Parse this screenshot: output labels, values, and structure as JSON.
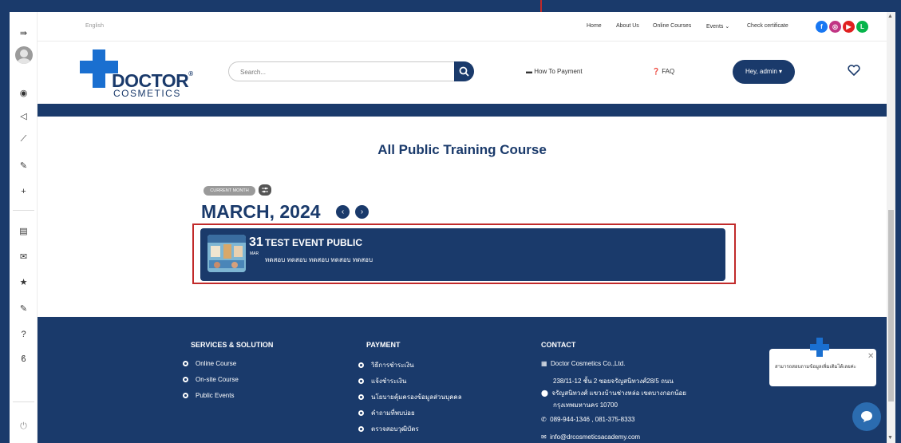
{
  "topbar": {
    "language": "English",
    "nav": [
      "Home",
      "About Us",
      "Online Courses",
      "Events",
      "Check certificate"
    ],
    "social": [
      {
        "name": "facebook-icon",
        "color": "#1877f2",
        "glyph": "f"
      },
      {
        "name": "instagram-icon",
        "color": "#c13584",
        "glyph": "◎"
      },
      {
        "name": "youtube-icon",
        "color": "#e02020",
        "glyph": "▶"
      },
      {
        "name": "line-icon",
        "color": "#06b44a",
        "glyph": "L"
      }
    ]
  },
  "header": {
    "logo_name": "DOCTOR",
    "logo_reg": "®",
    "logo_sub": "COSMETICS",
    "search_placeholder": "Search...",
    "how_to_payment": "How To Payment",
    "faq": "FAQ",
    "admin_label": "Hey, admin"
  },
  "main": {
    "title": "All Public Training Course",
    "current_month": "CURRENT MONTH",
    "month_title": "MARCH, 2024",
    "event": {
      "day": "31",
      "month_abbr": "MAR",
      "title": "TEST EVENT PUBLIC",
      "description": "ทดสอบ ทดสอบ ทดสอบ ทดสอบ ทดสอบ"
    }
  },
  "footer": {
    "services": {
      "heading": "SERVICES & SOLUTION",
      "items": [
        "Online Course",
        "On-site Course",
        "Public Events"
      ]
    },
    "payment": {
      "heading": "PAYMENT",
      "items": [
        "วิธีการชำระเงิน",
        "แจ้งชำระเงิน",
        "นโยบายคุ้มครองข้อมูลส่วนบุคคล",
        "คำถามที่พบบ่อย",
        "ตรวจสอบวุฒิบัตร"
      ]
    },
    "contact": {
      "heading": "CONTACT",
      "company": "Doctor Cosmetics Co.,Ltd.",
      "address": [
        "238/11-12 ชั้น 2 ซอยจรัญสนิทวงศ์28/5 ถนน",
        "จรัญสนิทวงศ์ แขวงบ้านช่างหล่อ เขตบางกอกน้อย",
        "กรุงเทพมหานคร 10700"
      ],
      "phone": "089-944-1346 , 081-375-8333",
      "email": "info@drcosmeticsacademy.com"
    }
  },
  "chat": {
    "text": "สามารถสอบถามข้อมูลเพิ่มเติมได้เลยค่ะ"
  },
  "colors": {
    "brand": "#1a3a6b",
    "accent": "#1a6fd0",
    "highlight": "#c12a2a"
  }
}
